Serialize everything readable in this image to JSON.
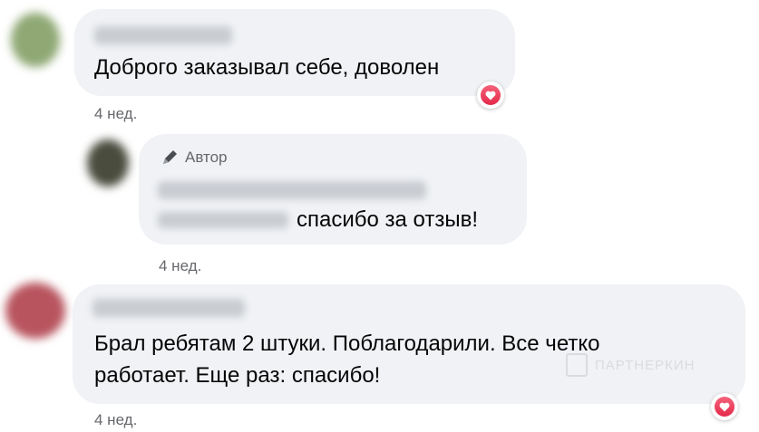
{
  "comments": [
    {
      "text": "Доброго заказывал себе, доволен",
      "time": "4 нед.",
      "reaction_icon": "heart-reaction-icon"
    },
    {
      "author_badge": "Автор",
      "text": "спасибо за отзыв!",
      "time": "4 нед."
    },
    {
      "text_line1": "Брал ребятам 2 штуки. Поблагодарили. Все четко",
      "text_line2": "работает. Еще раз: спасибо!",
      "time": "4 нед.",
      "reaction_icon": "heart-reaction-icon"
    }
  ],
  "watermark": "ПАРТНЕРКИН",
  "colors": {
    "bubble": "#f0f2f5",
    "meta_text": "#65676b",
    "reaction": "#e4294a"
  }
}
